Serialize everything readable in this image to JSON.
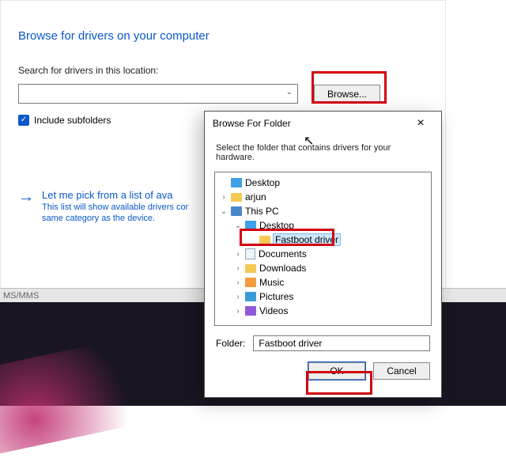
{
  "panel": {
    "title": "Browse for drivers on your computer",
    "search_label": "Search for drivers in this location:",
    "path_value": "",
    "browse_label": "Browse...",
    "include_subfolders_label": "Include subfolders",
    "include_subfolders_checked": true,
    "pick_heading": "Let me pick from a list of ava",
    "pick_sub1": "This list will show available drivers cor",
    "pick_sub2": "same category as the device."
  },
  "strip_text": "MS/MMS",
  "dialog": {
    "title": "Browse For Folder",
    "message": "Select the folder that contains drivers for your hardware.",
    "folder_label": "Folder:",
    "folder_value": "Fastboot driver",
    "ok_label": "OK",
    "cancel_label": "Cancel",
    "tree": [
      {
        "depth": 0,
        "expander": "",
        "icon": "desktop",
        "label": "Desktop"
      },
      {
        "depth": 0,
        "expander": ">",
        "icon": "folder",
        "label": "arjun"
      },
      {
        "depth": 0,
        "expander": "v",
        "icon": "pc",
        "label": "This PC"
      },
      {
        "depth": 1,
        "expander": "v",
        "icon": "desktop",
        "label": "Desktop"
      },
      {
        "depth": 2,
        "expander": "",
        "icon": "folder",
        "label": "Fastboot driver",
        "selected": true
      },
      {
        "depth": 1,
        "expander": ">",
        "icon": "doc",
        "label": "Documents"
      },
      {
        "depth": 1,
        "expander": ">",
        "icon": "folder",
        "label": "Downloads"
      },
      {
        "depth": 1,
        "expander": ">",
        "icon": "music",
        "label": "Music"
      },
      {
        "depth": 1,
        "expander": ">",
        "icon": "pic",
        "label": "Pictures"
      },
      {
        "depth": 1,
        "expander": ">",
        "icon": "vid",
        "label": "Videos"
      }
    ]
  },
  "highlight_color": "#d3000e"
}
